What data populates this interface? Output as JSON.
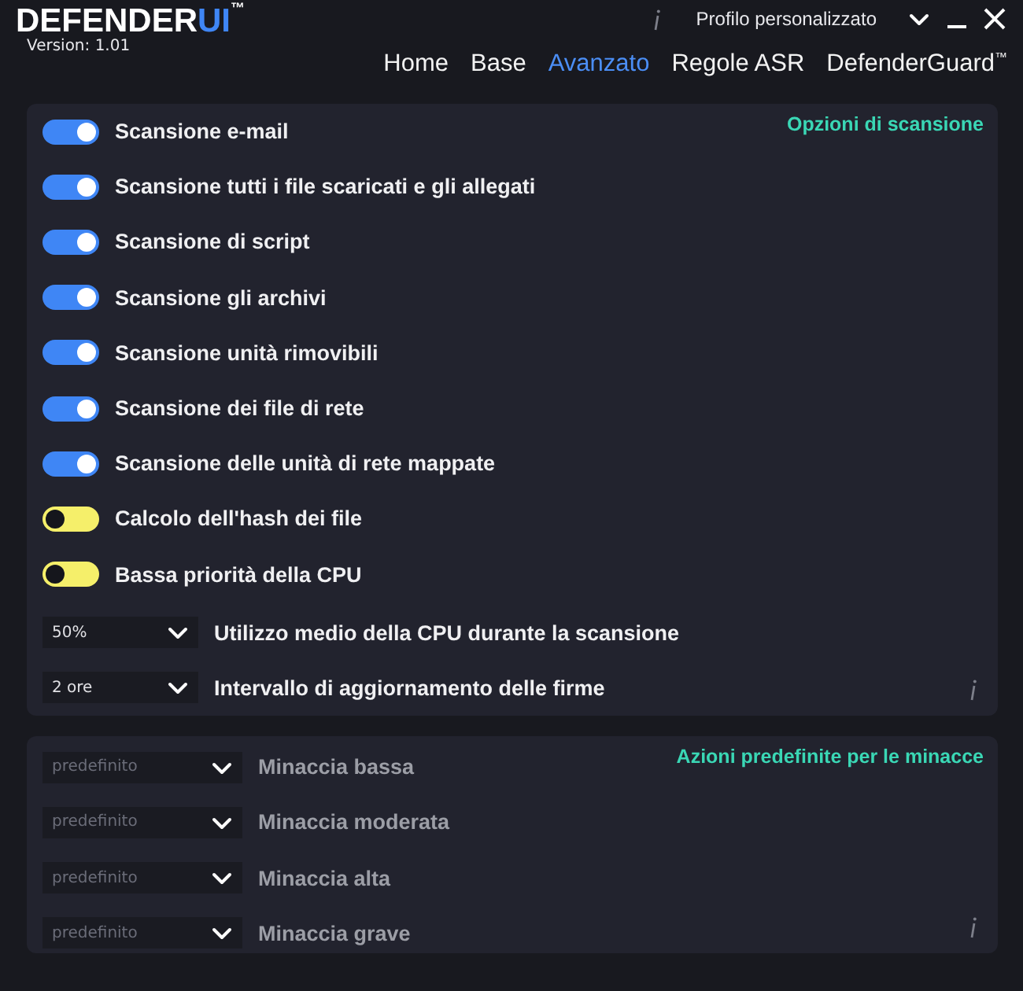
{
  "header": {
    "logo": {
      "main": "DEFENDER",
      "accent": "UI",
      "mark": "™"
    },
    "version": "Version: 1.01",
    "profile": "Profilo personalizzato"
  },
  "nav": [
    {
      "label": "Home",
      "selected": false
    },
    {
      "label": "Base",
      "selected": false
    },
    {
      "label": "Avanzato",
      "selected": true
    },
    {
      "label": "Regole ASR",
      "selected": false
    },
    {
      "label": "DefenderGuard$^{™}$",
      "selected": false
    }
  ],
  "scan_options": {
    "title": "Opzioni di scansione",
    "items": [
      {
        "kind": "toggle",
        "label": "Scansione e-mail",
        "on": true
      },
      {
        "kind": "toggle",
        "label": "Scansione tutti i file scaricati e gli allegati",
        "on": true
      },
      {
        "kind": "toggle",
        "label": "Scansione di script",
        "on": true
      },
      {
        "kind": "toggle",
        "label": "Scansione gli archivi",
        "on": true
      },
      {
        "kind": "toggle",
        "label": "Scansione unità rimovibili",
        "on": true
      },
      {
        "kind": "toggle",
        "label": "Scansione dei file di rete",
        "on": true
      },
      {
        "kind": "toggle",
        "label": "Scansione delle unità di rete mappate",
        "on": true
      },
      {
        "kind": "toggle",
        "label": "Calcolo dell'hash dei file",
        "on": false
      },
      {
        "kind": "toggle",
        "label": "Bassa priorità della CPU",
        "on": false
      },
      {
        "kind": "dropdown",
        "value": "50%",
        "label": "Utilizzo medio della CPU durante la scansione",
        "disabled": false
      },
      {
        "kind": "dropdown",
        "value": "2 ore",
        "label": "Intervallo di aggiornamento delle firme",
        "disabled": false
      }
    ]
  },
  "threat_actions": {
    "title": "Azioni predefinite per le minacce",
    "items": [
      {
        "kind": "dropdown",
        "value": "predefinito",
        "label": "Minaccia bassa",
        "disabled": true
      },
      {
        "kind": "dropdown",
        "value": "predefinito",
        "label": "Minaccia moderata",
        "disabled": true
      },
      {
        "kind": "dropdown",
        "value": "predefinito",
        "label": "Minaccia alta",
        "disabled": true
      },
      {
        "kind": "dropdown",
        "value": "predefinito",
        "label": "Minaccia grave",
        "disabled": true
      }
    ]
  }
}
